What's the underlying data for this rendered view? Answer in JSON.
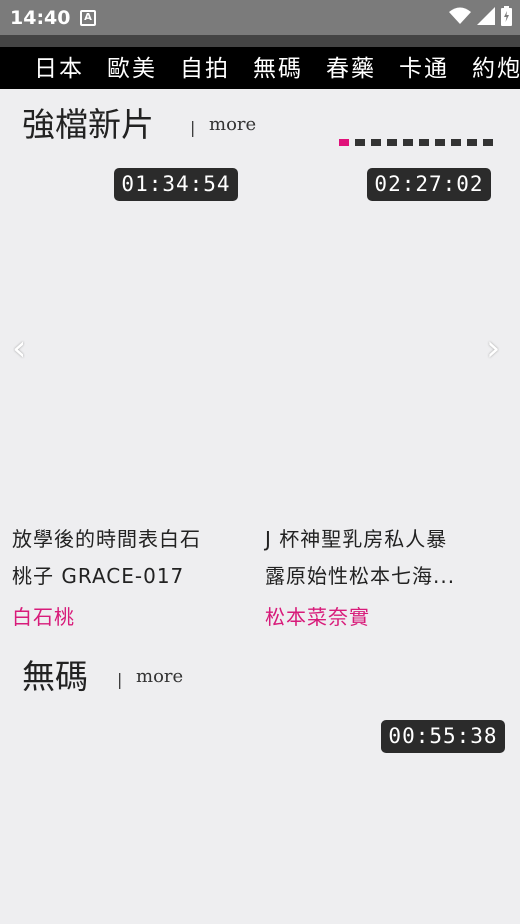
{
  "status": {
    "time": "14:40",
    "a_icon": "A"
  },
  "nav": {
    "items": [
      "日本",
      "歐美",
      "自拍",
      "無碼",
      "春藥",
      "卡通",
      "約炮"
    ]
  },
  "section1": {
    "title": "強檔新片",
    "sep": "|",
    "more": "more"
  },
  "section2": {
    "title": "無碼",
    "sep": "|",
    "more": "more"
  },
  "carousel": {
    "prev": "‹",
    "next": "›",
    "cards": [
      {
        "duration": "01:34:54",
        "title_line1": "放學後的時間表白石",
        "title_line2": "桃子 GRACE-017",
        "actor": "白石桃"
      },
      {
        "duration": "02:27:02",
        "title_line1": "J 杯神聖乳房私人暴",
        "title_line2": "露原始性松本七海...",
        "actor": "松本菜奈實"
      }
    ]
  },
  "section2_card": {
    "duration": "00:55:38"
  },
  "colors": {
    "accent": "#e0117a",
    "actor": "#d81b7a",
    "nav_bg": "#000000",
    "status_bg": "#7b7b7b"
  }
}
